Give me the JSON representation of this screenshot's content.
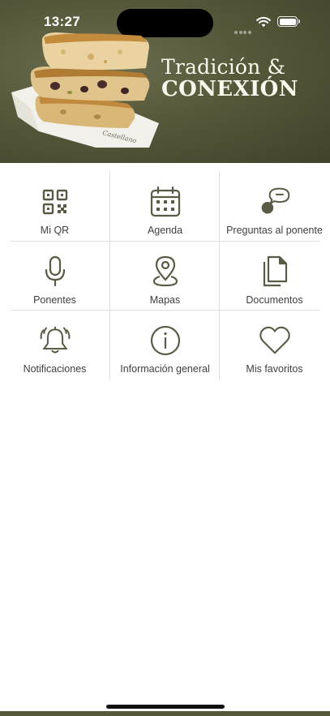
{
  "status_bar": {
    "time": "13:27"
  },
  "hero": {
    "title_line1": "Tradición &",
    "title_line2": "CONEXIÓN",
    "package_text": "Castellano",
    "background_color": "#555839"
  },
  "menu": {
    "items": [
      {
        "label": "Mi QR",
        "icon": "qr-code-icon"
      },
      {
        "label": "Agenda",
        "icon": "calendar-icon"
      },
      {
        "label": "Preguntas al ponente",
        "icon": "chat-bubble-icon"
      },
      {
        "label": "Ponentes",
        "icon": "microphone-icon"
      },
      {
        "label": "Mapas",
        "icon": "map-pin-icon"
      },
      {
        "label": "Documentos",
        "icon": "documents-icon"
      },
      {
        "label": "Notificaciones",
        "icon": "bell-icon"
      },
      {
        "label": "Información general",
        "icon": "info-icon"
      },
      {
        "label": "Mis favoritos",
        "icon": "heart-icon"
      }
    ],
    "icon_color": "#5b5a44",
    "divider_color": "#dedede"
  }
}
